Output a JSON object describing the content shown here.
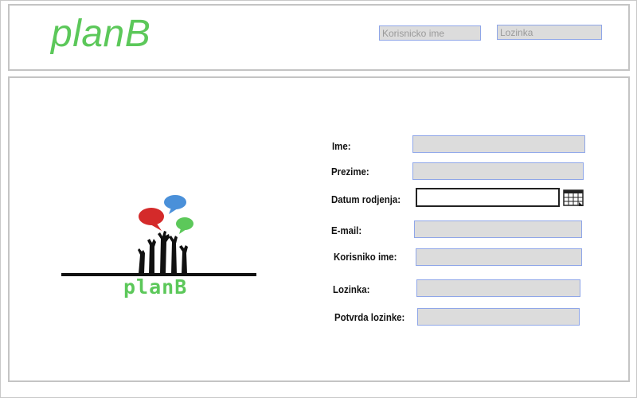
{
  "header": {
    "brand": "planB",
    "username": {
      "placeholder": "Korisnicko ime",
      "value": ""
    },
    "password": {
      "placeholder": "Lozinka",
      "value": ""
    }
  },
  "logo": {
    "text": "planB",
    "colors": {
      "speech_red": "#d42a2a",
      "speech_blue": "#4a90d9",
      "speech_green": "#5cc85a",
      "hands": "#111111"
    }
  },
  "form": {
    "ime_label": "Ime:",
    "prezime_label": "Prezime:",
    "datum_label": "Datum rodjenja:",
    "email_label": "E-mail:",
    "korisnicko_label": "Korisniko ime:",
    "lozinka_label": "Lozinka:",
    "potvrda_label": "Potvrda lozinke:",
    "calendar_icon": "calendar-icon"
  },
  "colors": {
    "accent": "#5cc85a",
    "field_bg": "#dcdcdc",
    "field_border": "#8fa6e8",
    "frame": "#c4c4c4"
  }
}
